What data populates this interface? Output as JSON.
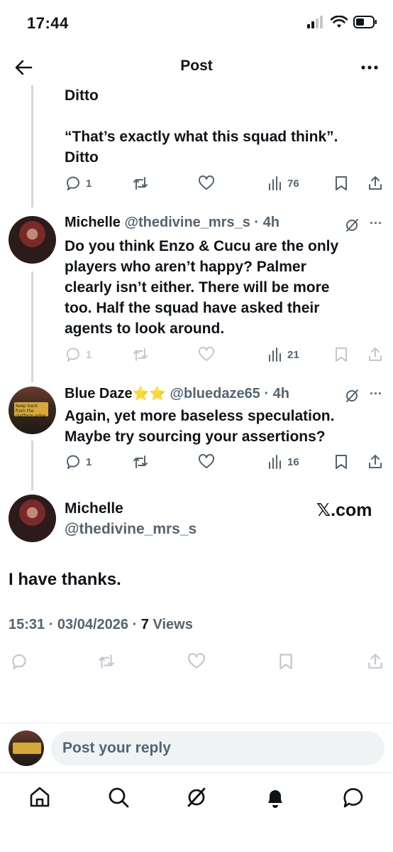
{
  "status_bar": {
    "time": "17:44"
  },
  "nav": {
    "title": "Post"
  },
  "tweet1": {
    "line1": "Ditto",
    "line2": "“That’s exactly what this squad think”.",
    "line3": "Ditto",
    "replies": "1",
    "views": "76"
  },
  "tweet2": {
    "name": "Michelle",
    "handle": "@thedivine_mrs_s",
    "time": "· 4h",
    "lines": [
      "Do you think Enzo & Cucu are the only",
      "players who aren’t happy?  Palmer",
      "clearly isn’t either.  There will be more",
      "too.  Half the squad have asked their",
      "agents to look around."
    ],
    "replies": "1",
    "views": "21"
  },
  "tweet3": {
    "name": "Blue Daze",
    "stars": "⭐⭐",
    "handle": "@bluedaze65",
    "time": "· 4h",
    "lines": [
      "Again, yet more baseless speculation.",
      "Maybe try sourcing your assertions?"
    ],
    "sign_text": "Keep back from the platform edge",
    "replies": "1",
    "views": "16"
  },
  "main_tweet": {
    "name": "Michelle",
    "handle": "@thedivine_mrs_s",
    "source": "𝕏.com",
    "text": "I have thanks.",
    "datetime": "15:31 · 03/04/2026 · ",
    "views_count": "7",
    "views_label": " Views"
  },
  "reply_bar": {
    "placeholder": "Post your reply"
  },
  "tabs": [
    "home-icon",
    "search-icon",
    "grok-icon",
    "notifications-icon",
    "messages-icon"
  ],
  "colors": {
    "text": "#0f1419",
    "secondary": "#536471",
    "thread_line": "#cfd9de",
    "input_bg": "#eff3f4"
  }
}
